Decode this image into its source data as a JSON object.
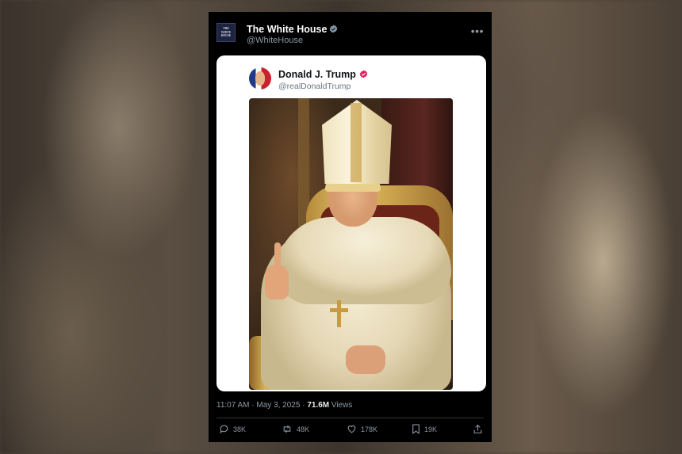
{
  "header": {
    "logo_lines": [
      "THE",
      "WHITE",
      "HOUSE"
    ],
    "name": "The White House",
    "handle": "@WhiteHouse",
    "more_icon": "ellipsis"
  },
  "embedded_post": {
    "name": "Donald J. Trump",
    "handle": "@realDonaldTrump",
    "image_description": "AI image of a man dressed as the pope seated on a golden throne, raising one finger"
  },
  "meta": {
    "time": "11:07 AM · May 3, 2025 · ",
    "views_count": "71.6M",
    "views_label": " Views"
  },
  "actions": {
    "replies": "38K",
    "reposts": "48K",
    "likes": "178K",
    "bookmarks": "19K"
  },
  "colors": {
    "verified_gray": "#829aab",
    "verified_pink": "#e0245e",
    "muted": "#8b98a5"
  }
}
